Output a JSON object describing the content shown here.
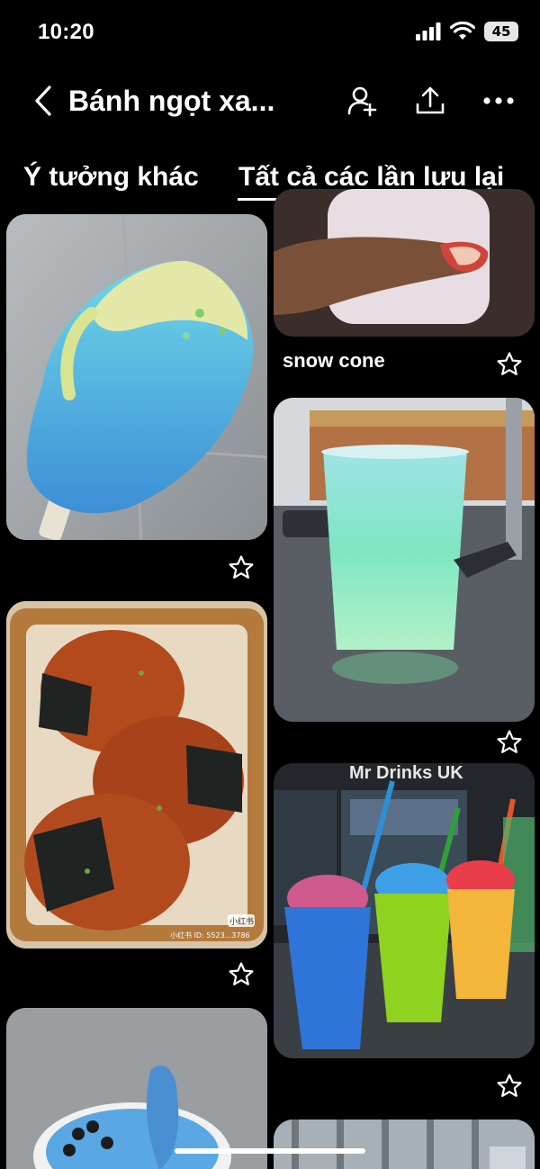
{
  "status_bar": {
    "time": "10:20",
    "battery": "45"
  },
  "header": {
    "title": "Bánh ngọt xa..."
  },
  "tabs": [
    {
      "label": "Ý tưởng khác",
      "active": false
    },
    {
      "label": "Tất cả các lần lưu lại",
      "active": true
    }
  ],
  "pins": {
    "blue_popsicle": {
      "caption": ""
    },
    "onigiri": {
      "caption": "",
      "watermark_logo": "小红书",
      "watermark_id": "小红书 ID: 5523...3786"
    },
    "blue_smoothie_bowl": {
      "caption": ""
    },
    "snow_cone": {
      "caption": "snow cone"
    },
    "green_slushie": {
      "caption": ""
    },
    "mr_drinks_slushies": {
      "caption": "",
      "sign_text": "Mr Drinks UK"
    },
    "storefront": {
      "caption": ""
    }
  },
  "icons": {
    "back": "chevron-left-icon",
    "collaborator": "add-person-icon",
    "share": "share-upload-icon",
    "more": "more-dots-icon",
    "save": "star-outline-icon"
  },
  "colors": {
    "background": "#000000",
    "text": "#ffffff"
  }
}
